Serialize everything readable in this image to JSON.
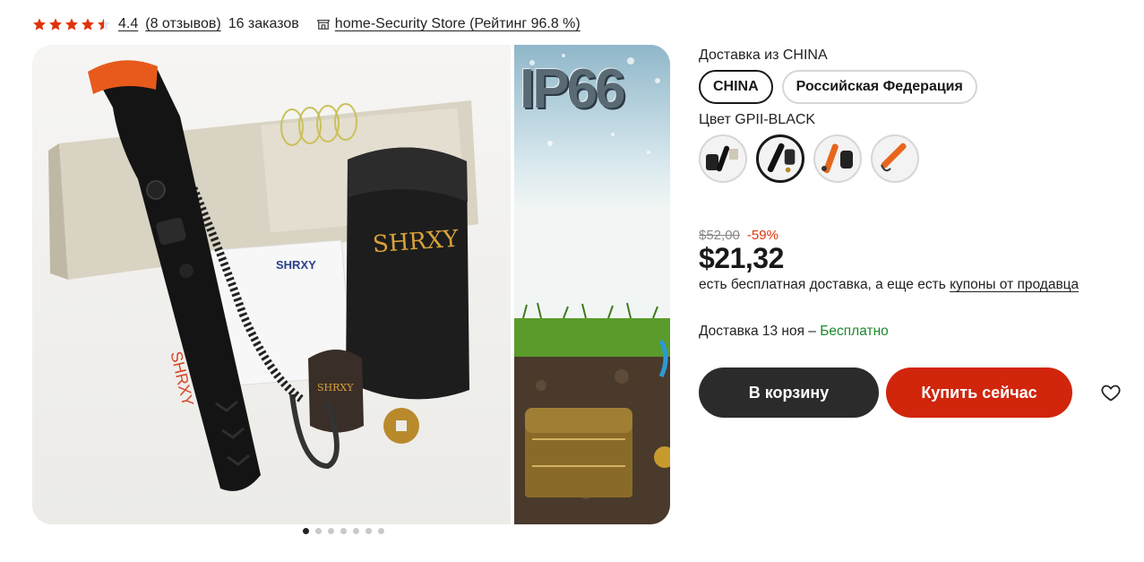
{
  "rating": {
    "stars_value": 4.4,
    "score": "4.4",
    "reviews": "(8 отзывов)",
    "orders": "16 заказов",
    "store": "home-Security Store (Рейтинг 96.8 %)",
    "star_color": "#e0330a"
  },
  "gallery": {
    "brand_text": "SHRXY",
    "ip_text": "IP66",
    "dots_count": 7,
    "active_dot": 0
  },
  "shipping": {
    "label": "Доставка из CHINA",
    "options": [
      "CHINA",
      "Российская Федерация"
    ],
    "selected": "CHINA"
  },
  "color": {
    "label": "Цвет GPII-BLACK",
    "swatch_icons": [
      "product-black-kit-icon",
      "product-black-probe-icon",
      "product-orange-kit-icon",
      "product-orange-probe-icon"
    ],
    "selected_index": 1
  },
  "price": {
    "old": "$52,00",
    "discount": "-59%",
    "current": "$21,32"
  },
  "notes": {
    "free_shipping_prefix": "есть бесплатная доставка, а еще есть ",
    "coupons_link": "купоны от продавца",
    "delivery_prefix": "Доставка 13 ноя – ",
    "delivery_free": "Бесплатно"
  },
  "buttons": {
    "cart": "В корзину",
    "buy": "Купить сейчас",
    "cart_color": "#2b2b2b",
    "buy_color": "#d1250c"
  }
}
